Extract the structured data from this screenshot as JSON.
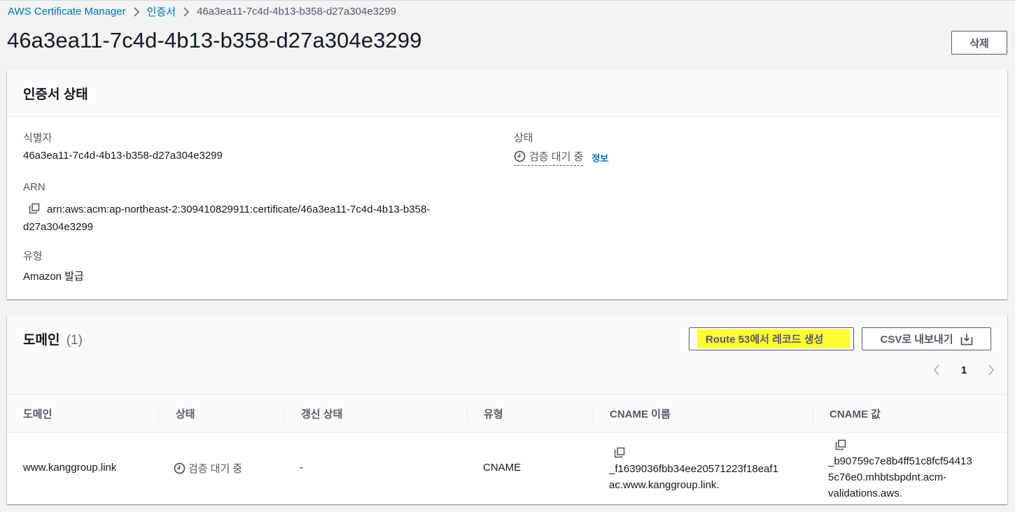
{
  "breadcrumb": {
    "root": "AWS Certificate Manager",
    "section": "인증서",
    "current": "46a3ea11-7c4d-4b13-b358-d27a304e3299"
  },
  "page": {
    "title": "46a3ea11-7c4d-4b13-b358-d27a304e3299",
    "delete_label": "삭제"
  },
  "status_panel": {
    "title": "인증서 상태",
    "identifier_label": "식별자",
    "identifier_value": "46a3ea11-7c4d-4b13-b358-d27a304e3299",
    "arn_label": "ARN",
    "arn_value": "arn:aws:acm:ap-northeast-2:309410829911:certificate/46a3ea11-7c4d-4b13-b358-d27a304e3299",
    "type_label": "유형",
    "type_value": "Amazon 발급",
    "status_label": "상태",
    "status_value": "검증 대기 중",
    "info_link": "정보"
  },
  "domains_panel": {
    "title": "도메인",
    "count": "(1)",
    "route53_label": "Route 53에서 레코드 생성",
    "csv_label": "CSV로 내보내기",
    "page_number": "1",
    "columns": [
      "도메인",
      "상태",
      "갱신 상태",
      "유형",
      "CNAME 이름",
      "CNAME 값"
    ],
    "rows": [
      {
        "domain": "www.kanggroup.link",
        "status": "검증 대기 중",
        "renewal": "-",
        "type": "CNAME",
        "cname_name_line1": "_f1639036fbb34ee20571223f18eaf1",
        "cname_name_line2": "ac.www.kanggroup.link.",
        "cname_value_line1": "_b90759c7e8b4ff51c8fcf54413",
        "cname_value_line2": "5c76e0.mhbtsbpdnt.acm-",
        "cname_value_line3": "validations.aws."
      }
    ]
  },
  "colors": {
    "link": "#0073bb",
    "highlight": "#ffff33",
    "text": "#16191f",
    "muted": "#545b64"
  }
}
